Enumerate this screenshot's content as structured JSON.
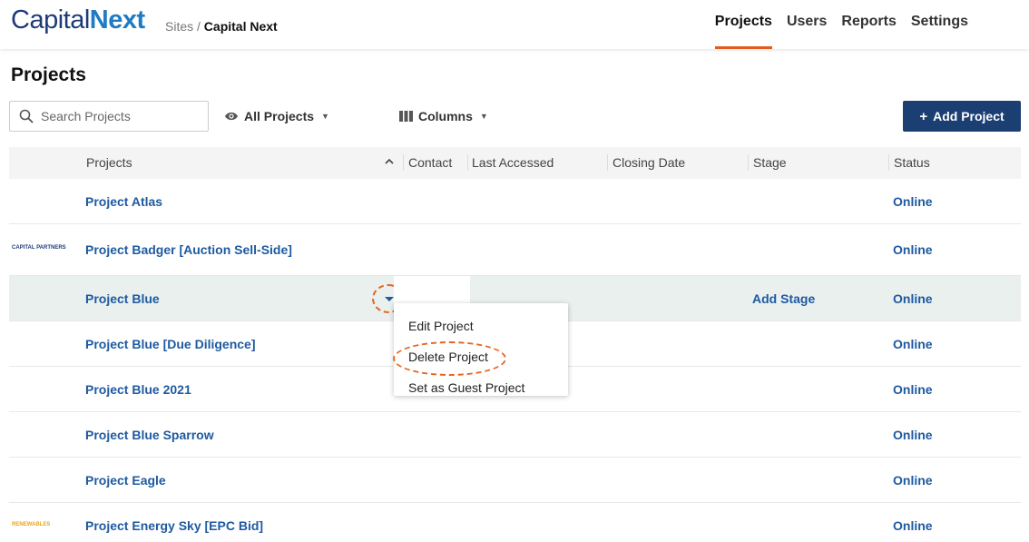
{
  "header": {
    "logo_part1": "Capital",
    "logo_part2": "Next",
    "breadcrumb_parent": "Sites /",
    "breadcrumb_current": "Capital Next",
    "nav": [
      {
        "label": "Projects",
        "active": true
      },
      {
        "label": "Users",
        "active": false
      },
      {
        "label": "Reports",
        "active": false
      },
      {
        "label": "Settings",
        "active": false
      }
    ]
  },
  "page": {
    "title": "Projects"
  },
  "toolbar": {
    "search_placeholder": "Search Projects",
    "filter_label": "All Projects",
    "columns_label": "Columns",
    "add_label": "Add Project"
  },
  "table": {
    "columns": [
      "Projects",
      "Contact",
      "Last Accessed",
      "Closing Date",
      "Stage",
      "Status"
    ],
    "rows": [
      {
        "name": "Project Atlas",
        "status": "Online",
        "logo": ""
      },
      {
        "name": "Project Badger [Auction Sell-Side]",
        "status": "Online",
        "logo": "CAPITAL PARTNERS"
      },
      {
        "name": "Project Blue",
        "status": "Online",
        "stage": "Add Stage",
        "logo": ""
      },
      {
        "name": "Project Blue [Due Diligence]",
        "status": "Online",
        "logo": ""
      },
      {
        "name": "Project Blue 2021",
        "status": "Online",
        "logo": ""
      },
      {
        "name": "Project Blue Sparrow",
        "status": "Online",
        "logo": ""
      },
      {
        "name": "Project Eagle",
        "status": "Online",
        "logo": ""
      },
      {
        "name": "Project Energy Sky [EPC Bid]",
        "status": "Online",
        "logo": "RENEWABLES"
      }
    ]
  },
  "context_menu": {
    "items": [
      "Edit Project",
      "Delete Project",
      "Set as Guest Project"
    ]
  },
  "colors": {
    "accent": "#e65a1e",
    "brand_dark": "#1c3f73",
    "link": "#1e5aa0"
  }
}
